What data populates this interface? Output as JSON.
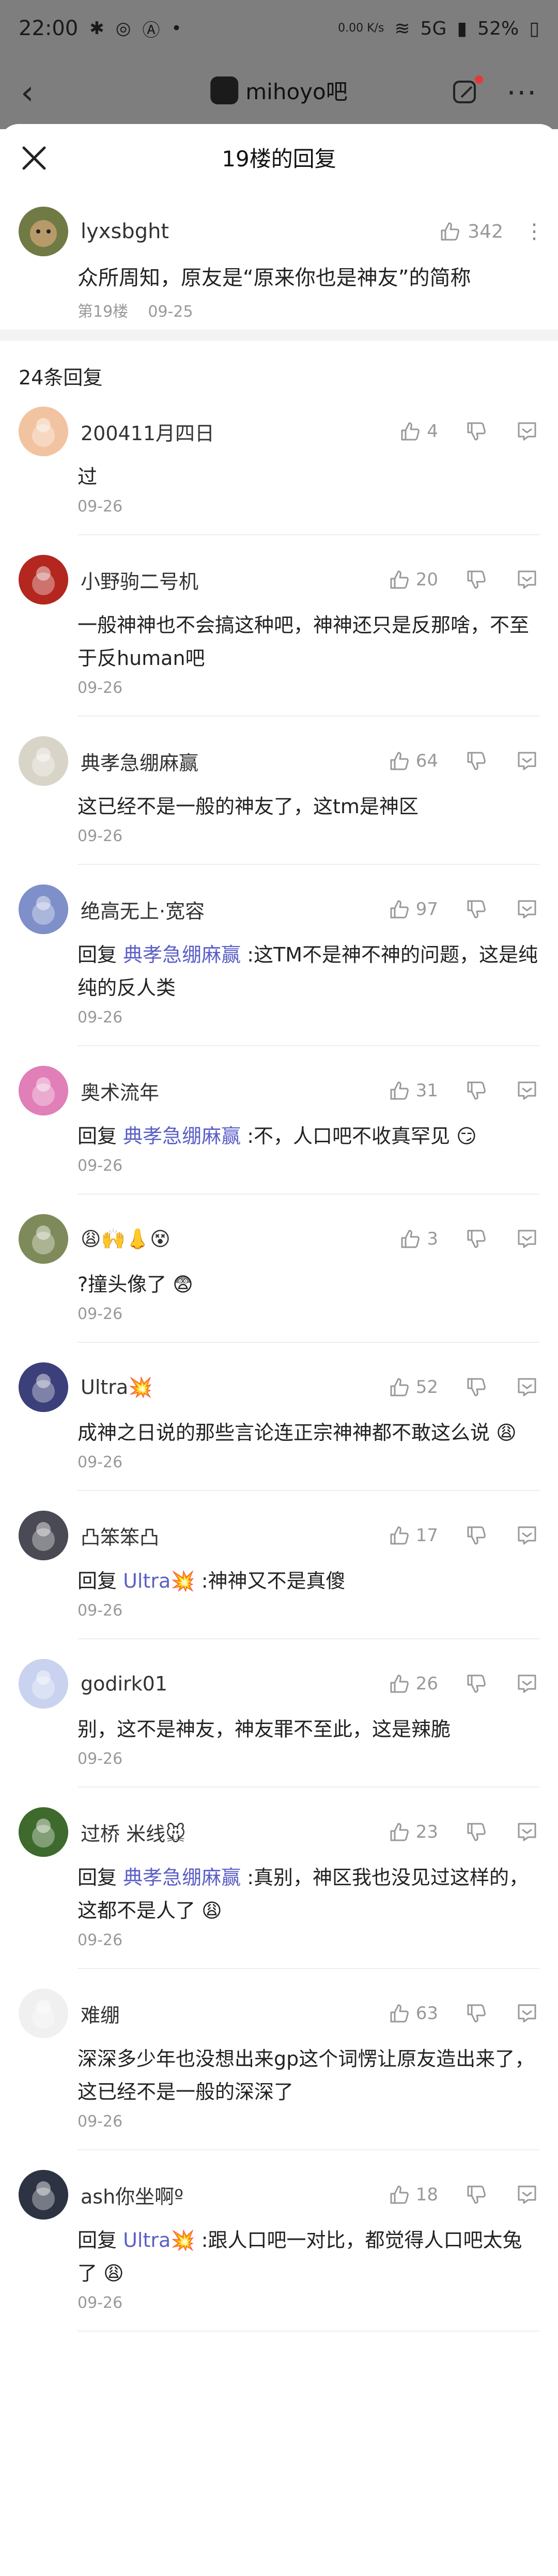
{
  "status_bar": {
    "time": "22:00",
    "left_icons": [
      "notification-icon",
      "notification-icon",
      "notification-icon",
      "dot"
    ],
    "speed": "0.00 K/s",
    "network": "5G",
    "battery": "52%"
  },
  "background_nav": {
    "forum_name": "mihoyo吧"
  },
  "sheet": {
    "title": "19楼的回复"
  },
  "main_post": {
    "username": "lyxsbght",
    "likes": "342",
    "text": "众所周知，原友是“原来你也是神友”的简称",
    "floor": "第19楼",
    "date": "09-25"
  },
  "replies_count": "24条回复",
  "replies": [
    {
      "username": "200411月四日",
      "likes": "4",
      "prefix": "",
      "mention": "",
      "text": "过",
      "date": "09-26",
      "avatar_color": "#f2c3a0"
    },
    {
      "username": "小野驹二号机",
      "likes": "20",
      "prefix": "",
      "mention": "",
      "text": "一般神神也不会搞这种吧，神神还只是反那啥，不至于反human吧",
      "date": "09-26",
      "avatar_color": "#b3271f"
    },
    {
      "username": "典孝急绷麻赢",
      "likes": "64",
      "prefix": "",
      "mention": "",
      "text": "这已经不是一般的神友了，这tm是神区",
      "date": "09-26",
      "avatar_color": "#d9d4c8"
    },
    {
      "username": "绝高无上·宽容",
      "likes": "97",
      "prefix": "回复 ",
      "mention": "典孝急绷麻赢",
      "text": ":这TM不是神不神的问题，这是纯纯的反人类",
      "date": "09-26",
      "avatar_color": "#7e8fc9"
    },
    {
      "username": "奥术流年",
      "likes": "31",
      "prefix": "回复 ",
      "mention": "典孝急绷麻赢",
      "text": ":不，人口吧不收真罕见 😏",
      "date": "09-26",
      "avatar_color": "#e07fb8"
    },
    {
      "username": "😩🙌👃😵",
      "likes": "3",
      "prefix": "",
      "mention": "",
      "text": "?撞头像了 😨",
      "date": "09-26",
      "avatar_color": "#7f8a5a"
    },
    {
      "username": "Ultra💥",
      "likes": "52",
      "prefix": "",
      "mention": "",
      "text": "成神之日说的那些言论连正宗神神都不敢这么说 😩",
      "date": "09-26",
      "avatar_color": "#3b3f7a"
    },
    {
      "username": "凸笨笨凸",
      "likes": "17",
      "prefix": "回复 ",
      "mention": "Ultra💥",
      "text": ":神神又不是真傻",
      "date": "09-26",
      "avatar_color": "#4a4a55"
    },
    {
      "username": "godirk01",
      "likes": "26",
      "prefix": "",
      "mention": "",
      "text": "别，这不是神友，神友罪不至此，这是辣脆",
      "date": "09-26",
      "avatar_color": "#c9d3f0"
    },
    {
      "username": "过桥 米线🐭",
      "likes": "23",
      "prefix": "回复 ",
      "mention": "典孝急绷麻赢",
      "text": ":真别，神区我也没见过这样的，这都不是人了 😩",
      "date": "09-26",
      "avatar_color": "#3e6a2d"
    },
    {
      "username": "难绷",
      "likes": "63",
      "prefix": "",
      "mention": "",
      "text": "深深多少年也没想出来gp这个词愣让原友造出来了，这已经不是一般的深深了",
      "date": "09-26",
      "avatar_color": "#f0f0f0"
    },
    {
      "username": "ash你坐啊º",
      "likes": "18",
      "prefix": "回复 ",
      "mention": "Ultra💥",
      "text": ":跟人口吧一对比，都觉得人口吧太兔了 😩",
      "date": "09-26",
      "avatar_color": "#2d3342"
    }
  ]
}
